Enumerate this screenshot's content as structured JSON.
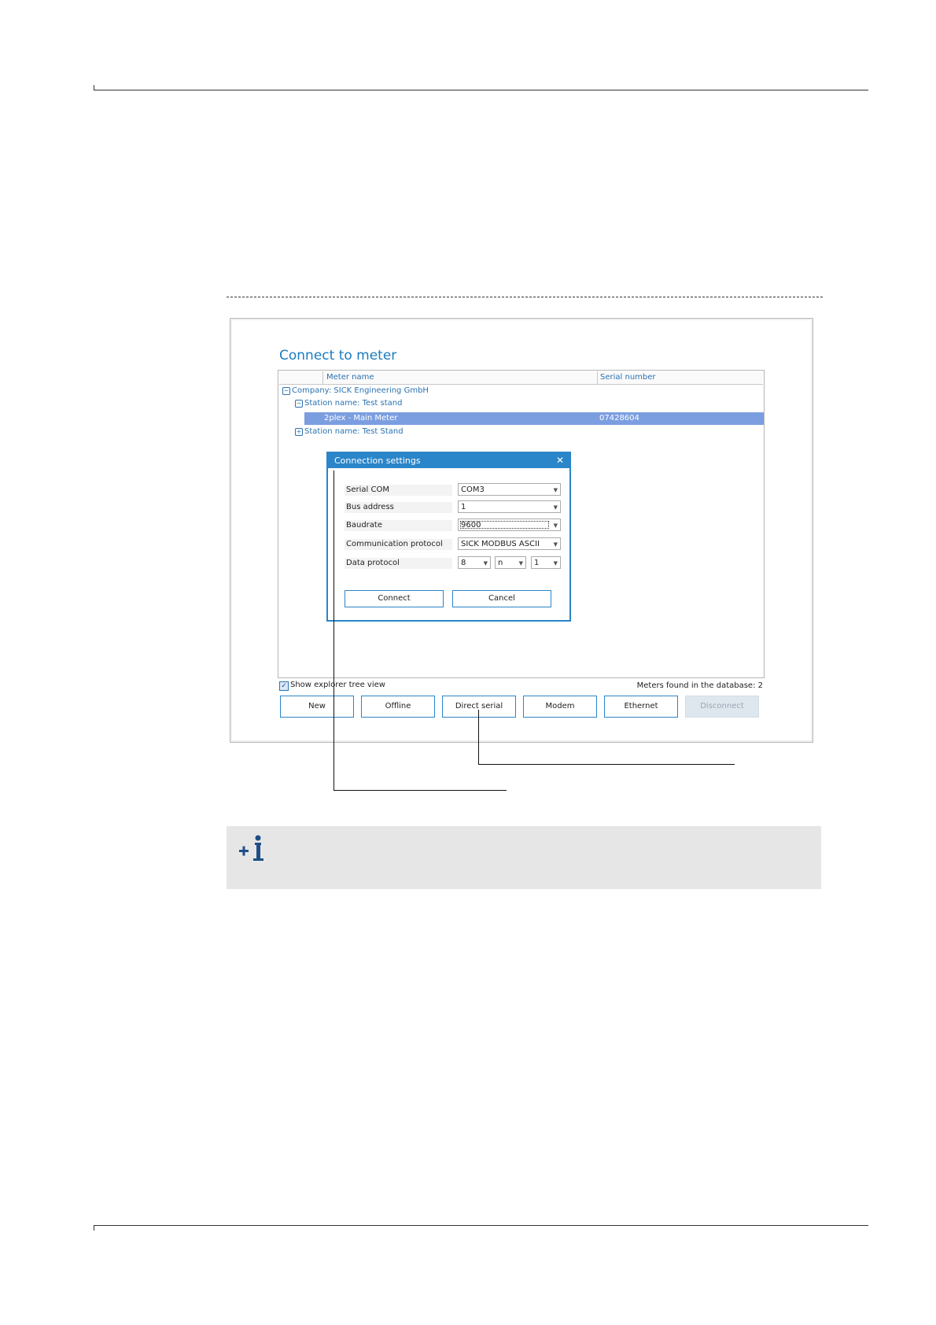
{
  "window_title": "Connect to meter",
  "grid": {
    "col_name": "Meter name",
    "col_serial": "Serial number",
    "company": "Company: SICK Engineering GmbH",
    "station1": "Station name: Test stand",
    "meter_name": "2plex - Main Meter",
    "meter_serial": "07428604",
    "station2": "Station name: Test Stand"
  },
  "dialog": {
    "title": "Connection settings",
    "close_glyph": "✕",
    "serial_com_label": "Serial COM",
    "serial_com_value": "COM3",
    "bus_address_label": "Bus address",
    "bus_address_value": "1",
    "baudrate_label": "Baudrate",
    "baudrate_value": "9600",
    "protocol_label": "Communication protocol",
    "protocol_value": "SICK MODBUS ASCII",
    "data_protocol_label": "Data protocol",
    "data_bits": "8",
    "parity": "n",
    "stop_bits": "1",
    "connect_label": "Connect",
    "cancel_label": "Cancel"
  },
  "footer": {
    "show_tree_label": "Show explorer tree view",
    "show_tree_checked": true,
    "meters_found": "Meters found in the database: 2"
  },
  "buttons": {
    "new": "New",
    "offline": "Offline",
    "direct_serial": "Direct serial",
    "modem": "Modem",
    "ethernet": "Ethernet",
    "disconnect": "Disconnect"
  },
  "icons": {
    "collapse": "minus-box-icon",
    "expand": "plus-box-icon",
    "dropdown": "chevron-down-icon",
    "info": "info-plus-icon"
  },
  "colors": {
    "accent": "#2a85c9",
    "link": "#2a72b0",
    "selection": "#7b9ee0",
    "note_bg": "#e6e6e6"
  }
}
